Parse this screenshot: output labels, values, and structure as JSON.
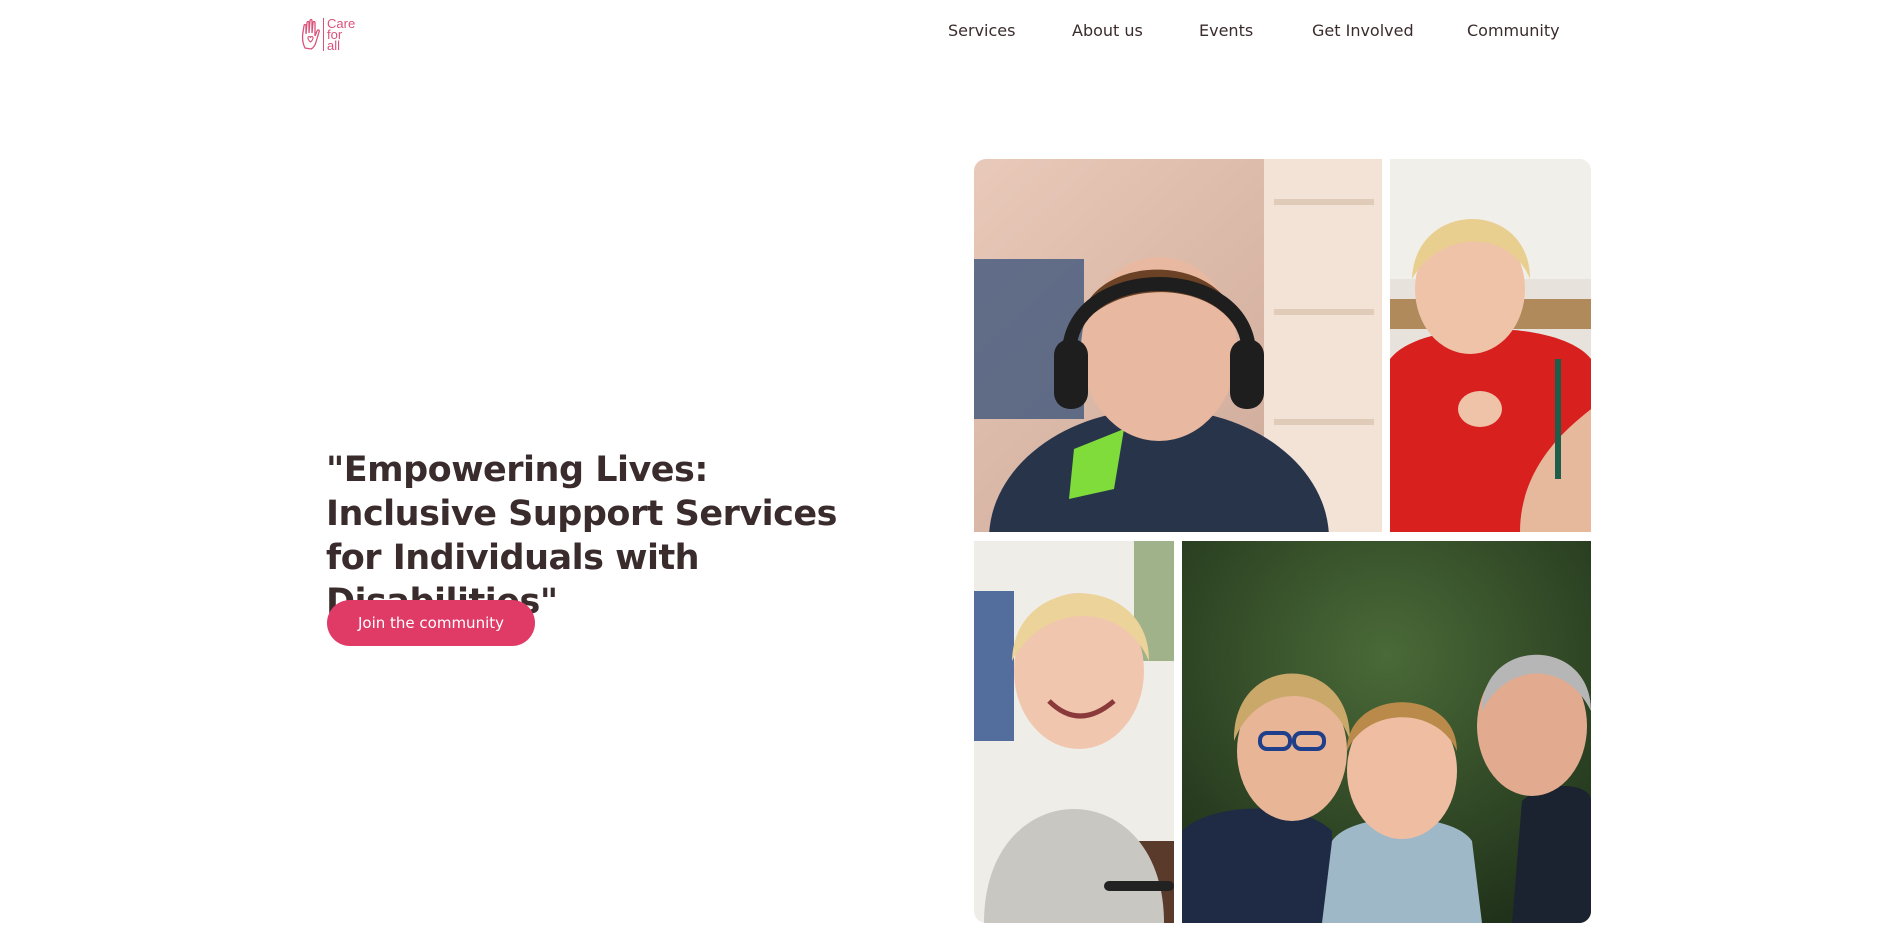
{
  "logo": {
    "lines": [
      "Care",
      "for",
      "all"
    ],
    "icon": "hand-heart-icon",
    "color": "#d9527a"
  },
  "nav": {
    "items": [
      {
        "label": "Services"
      },
      {
        "label": "About us"
      },
      {
        "label": "Events"
      },
      {
        "label": "Get Involved"
      },
      {
        "label": "Community"
      }
    ]
  },
  "hero": {
    "title": "\"Empowering Lives: Inclusive Support Services for Individuals with Disabilities\"",
    "cta_label": "Join the community",
    "cta_color": "#e03a66"
  },
  "gallery": {
    "photos": [
      {
        "name": "photo-child-headphones"
      },
      {
        "name": "photo-child-red-shirt"
      },
      {
        "name": "photo-child-smiling"
      },
      {
        "name": "photo-family-hug"
      }
    ]
  }
}
